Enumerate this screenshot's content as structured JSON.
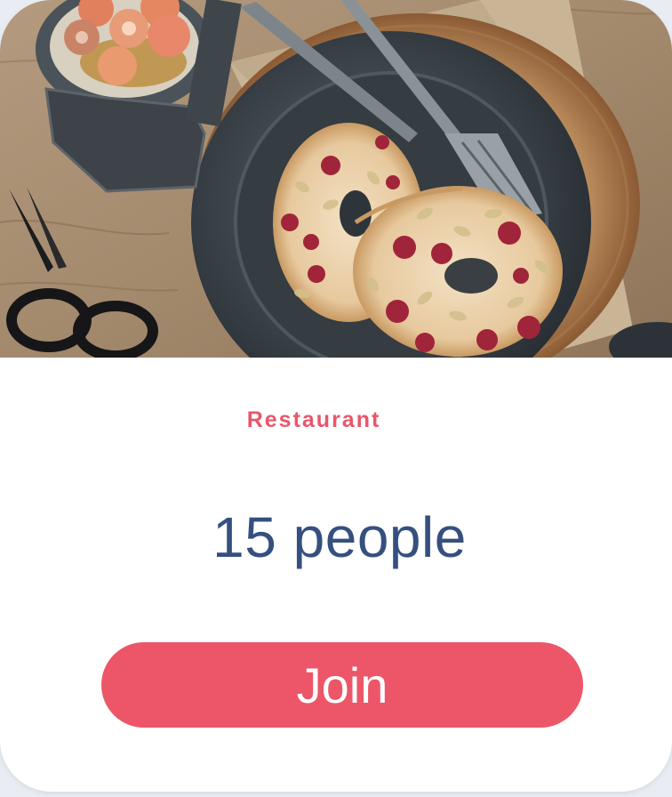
{
  "card": {
    "image_subject": "bagel-with-cream-cheese-seeds-and-cranberries",
    "category": "Restaurant",
    "people_count": "15 people",
    "join_label": "Join"
  },
  "colors": {
    "accent": "#ec5668",
    "category_text": "#e8566a",
    "count_text": "#35507f",
    "card_background": "#ffffff"
  }
}
